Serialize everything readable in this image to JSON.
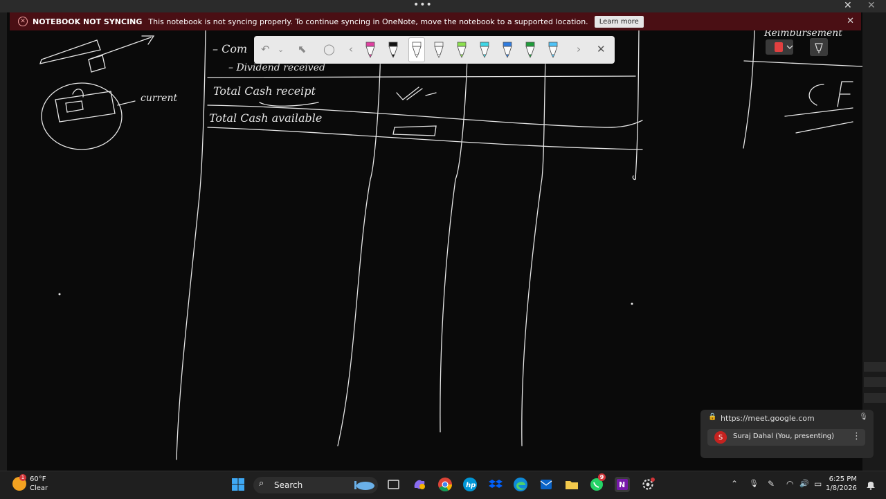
{
  "window": {
    "more_glyph": "•••",
    "close_glyph": "✕"
  },
  "banner": {
    "title": "NOTEBOOK NOT SYNCING",
    "message": "This notebook is not syncing properly. To continue syncing in OneNote, move the notebook to a supported location.",
    "learn_more": "Learn more",
    "close_glyph": "✕"
  },
  "canvas": {
    "ink_lines": [
      "– Com",
      "– Dividend received",
      "Total Cash receipt",
      "Total Cash available",
      "current",
      "C F",
      "Reimbursement"
    ]
  },
  "pen_toolbar": {
    "undo_glyph": "↶",
    "dropdown_glyph": "⌄",
    "select_glyph": "⬉",
    "lasso_glyph": "◯",
    "prev_glyph": "‹",
    "next_glyph": "›",
    "close_glyph": "✕",
    "pens": [
      {
        "name": "pink-pen",
        "color": "#e040a0"
      },
      {
        "name": "black-pen",
        "color": "#111111"
      },
      {
        "name": "white-pen",
        "color": "#ffffff",
        "selected": true
      },
      {
        "name": "white-pen-2",
        "color": "#f5f5f5"
      },
      {
        "name": "green-highlighter",
        "color": "#8be04e"
      },
      {
        "name": "cyan-highlighter",
        "color": "#3fd7e6"
      },
      {
        "name": "blue-pen",
        "color": "#2f7ce0"
      },
      {
        "name": "dark-green-pen",
        "color": "#1f9d3a"
      },
      {
        "name": "light-blue-pen",
        "color": "#4fc3f7"
      }
    ]
  },
  "meet": {
    "url": "https://meet.google.com",
    "avatar_initial": "S",
    "presenter": "Suraj Dahal (You, presenting)",
    "kebab": "⋮"
  },
  "taskbar": {
    "temperature": "60°F",
    "condition": "Clear",
    "weather_badge": "1",
    "search_label": "Search",
    "whatsapp_badge": "9",
    "time": "6:25 PM",
    "date": "1/8/2026",
    "tray_glyphs": {
      "chevron": "⌃",
      "mic": "🎙",
      "pen": "✎",
      "wifi": "◠",
      "volume": "🔊",
      "battery": "▭"
    }
  },
  "colors": {
    "banner_bg": "#4a0f14",
    "ink": "#e6e6e6",
    "toolbar_bg": "#e9e9e9",
    "taskbar_bg": "#1f1f1f"
  }
}
